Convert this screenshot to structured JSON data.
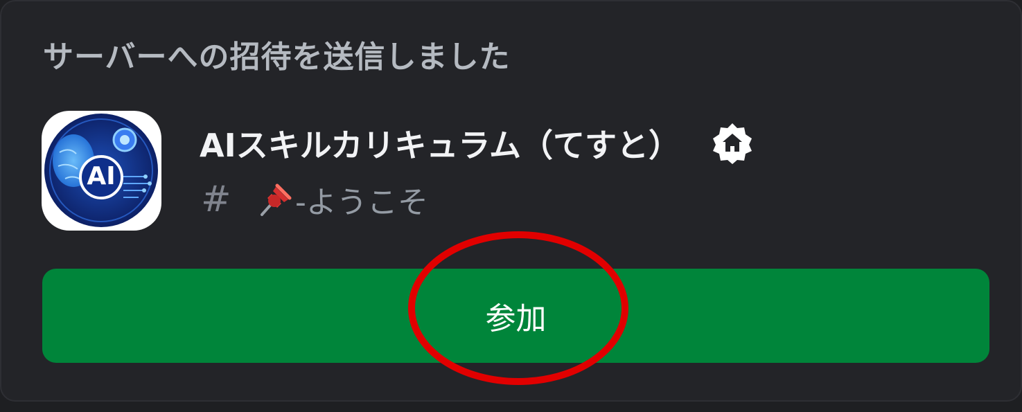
{
  "invite": {
    "header": "サーバーへの招待を送信しました",
    "server": {
      "name": "AIスキルカリキュラム（てすと）",
      "icon_text": "AI",
      "icon_name": "ai-brain-server-icon",
      "badge_icon": "home-badge-icon"
    },
    "channel": {
      "hash": "#",
      "emoji_icon": "pushpin-icon",
      "name": "-ようこそ"
    },
    "join_button_label": "参加"
  },
  "colors": {
    "background": "#232428",
    "button": "#00853a",
    "annotation": "#e10000"
  }
}
